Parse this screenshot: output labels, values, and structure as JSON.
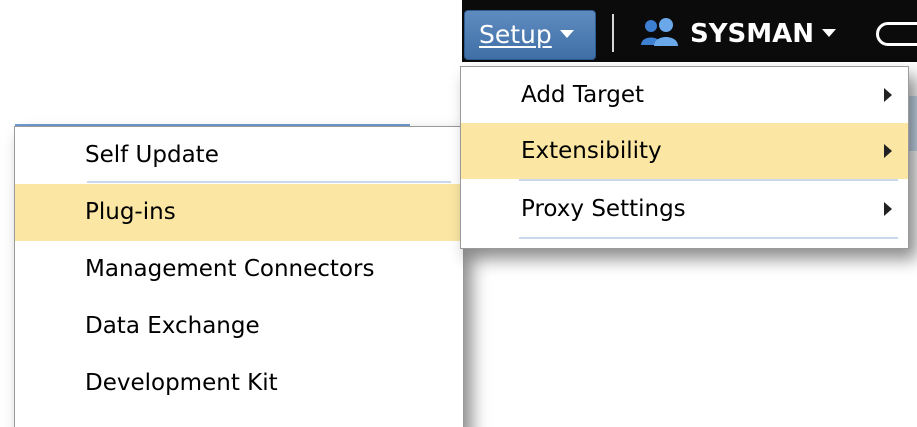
{
  "header": {
    "setup_label": "Setup",
    "user_label": "SYSMAN"
  },
  "setup_menu": {
    "items": [
      {
        "label": "Add Target",
        "has_submenu": true,
        "highlighted": false
      },
      {
        "label": "Extensibility",
        "has_submenu": true,
        "highlighted": true
      },
      {
        "label": "Proxy Settings",
        "has_submenu": true,
        "highlighted": false
      }
    ]
  },
  "extensibility_menu": {
    "items": [
      {
        "label": "Self Update",
        "highlighted": false
      },
      {
        "label": "Plug-ins",
        "highlighted": true
      },
      {
        "label": "Management Connectors",
        "highlighted": false
      },
      {
        "label": "Data Exchange",
        "highlighted": false
      },
      {
        "label": "Development Kit",
        "highlighted": false
      }
    ]
  },
  "colors": {
    "header_bg": "#0b0b0b",
    "setup_button": "#4a7bb3",
    "highlight": "#fbe7a3"
  },
  "icons": [
    "chevron-down-icon",
    "users-icon",
    "submenu-arrow-icon"
  ]
}
